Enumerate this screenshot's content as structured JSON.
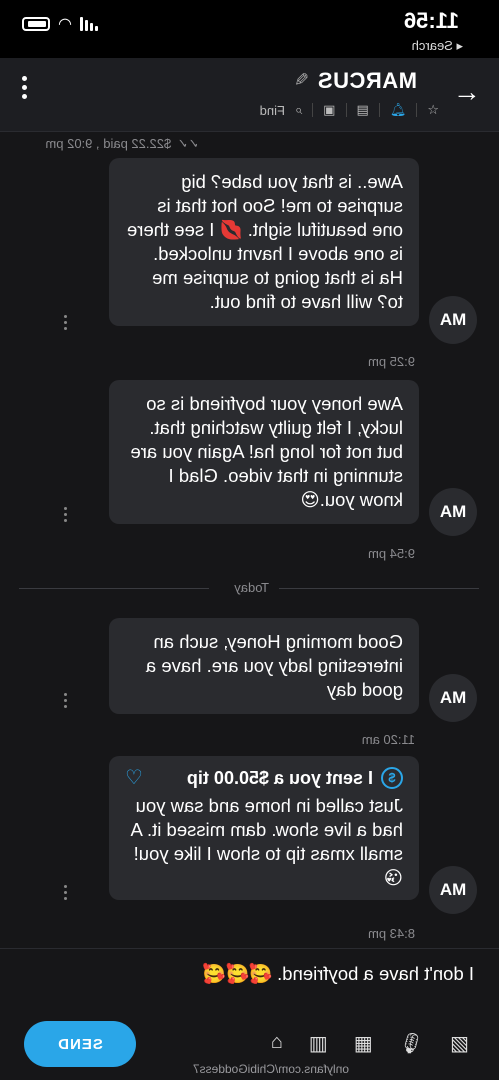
{
  "status": {
    "time": "11:56",
    "back_app": "◂ Search"
  },
  "header": {
    "name": "MARCUS",
    "find": "Find"
  },
  "paid_line": {
    "text": "$22.22 paid , 9:02 pm"
  },
  "messages": [
    {
      "avatar": "MA",
      "text": "Awe.. is that you babe? big surprise to me! Soo hot that is one beautiful sight. 💋 I see there is one above I havnt unlocked. Ha is that going to surprise me to? will have to find out.",
      "time": "9:25 pm"
    },
    {
      "avatar": "MA",
      "text": "Awe honey your boyfriend is so lucky, I felt guilty watching that. but not for long ha! Again you are stunning in that video. Glad I know you.😍",
      "time": "9:54 pm"
    },
    {
      "avatar": "MA",
      "text": "Good morning Honey, such an interesting lady you are. have a good day",
      "time": "11:20 am"
    },
    {
      "avatar": "MA",
      "tip": "I sent you a $50.00 tip",
      "text": "Just called in home and saw you had a live show. dam missed it. A small xmas tip to show I like you!😘",
      "time": "8:43 pm"
    }
  ],
  "divider": {
    "label": "Today"
  },
  "composer": {
    "input_value": "I don't have a boyfriend. 🥰🥰🥰",
    "send_label": "SEND"
  },
  "footer": {
    "url": "onlyfans.com/ChibiGoddess7"
  },
  "colors": {
    "accent": "#2aa6e8",
    "bubble": "#2a2b2f",
    "background": "#161618"
  }
}
